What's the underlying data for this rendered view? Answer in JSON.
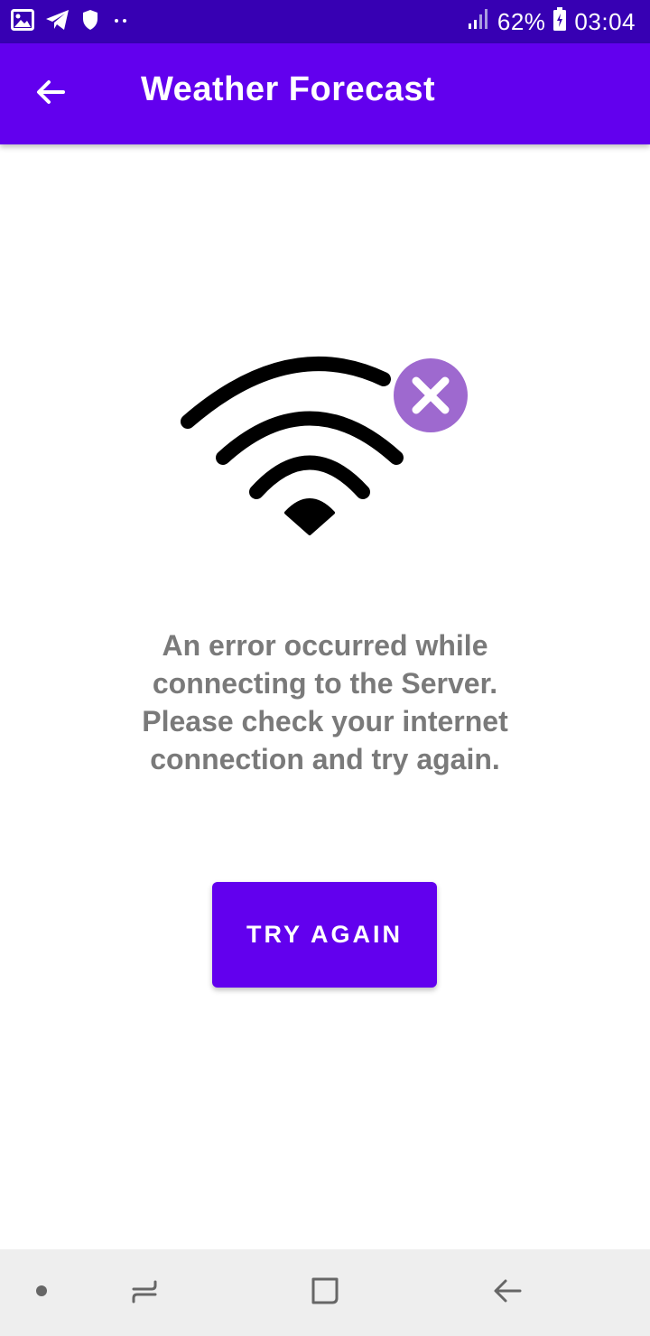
{
  "status_bar": {
    "icons_left": [
      "image-icon",
      "telegram-icon",
      "shield-icon",
      "more-dots-icon"
    ],
    "signal_icon": "signal-icon",
    "battery_percent": "62%",
    "battery_icon": "battery-charging-icon",
    "time": "03:04"
  },
  "app_bar": {
    "back_icon": "arrow-back-icon",
    "title": "Weather Forecast"
  },
  "error": {
    "illustration_icon": "wifi-off-icon",
    "badge_icon": "close-icon",
    "badge_color": "#9E69CF",
    "message": "An error occurred while\nconnecting to the Server.\nPlease check your internet\nconnection and try again."
  },
  "actions": {
    "try_again_label": "TRY AGAIN"
  },
  "colors": {
    "status_bar": "#3700B3",
    "primary": "#6200EE",
    "message_text": "#7a7a7a",
    "nav_background": "#eeeeee"
  },
  "nav_bar": {
    "items": [
      "dot-icon",
      "recent-apps-icon",
      "home-icon",
      "back-icon"
    ]
  }
}
